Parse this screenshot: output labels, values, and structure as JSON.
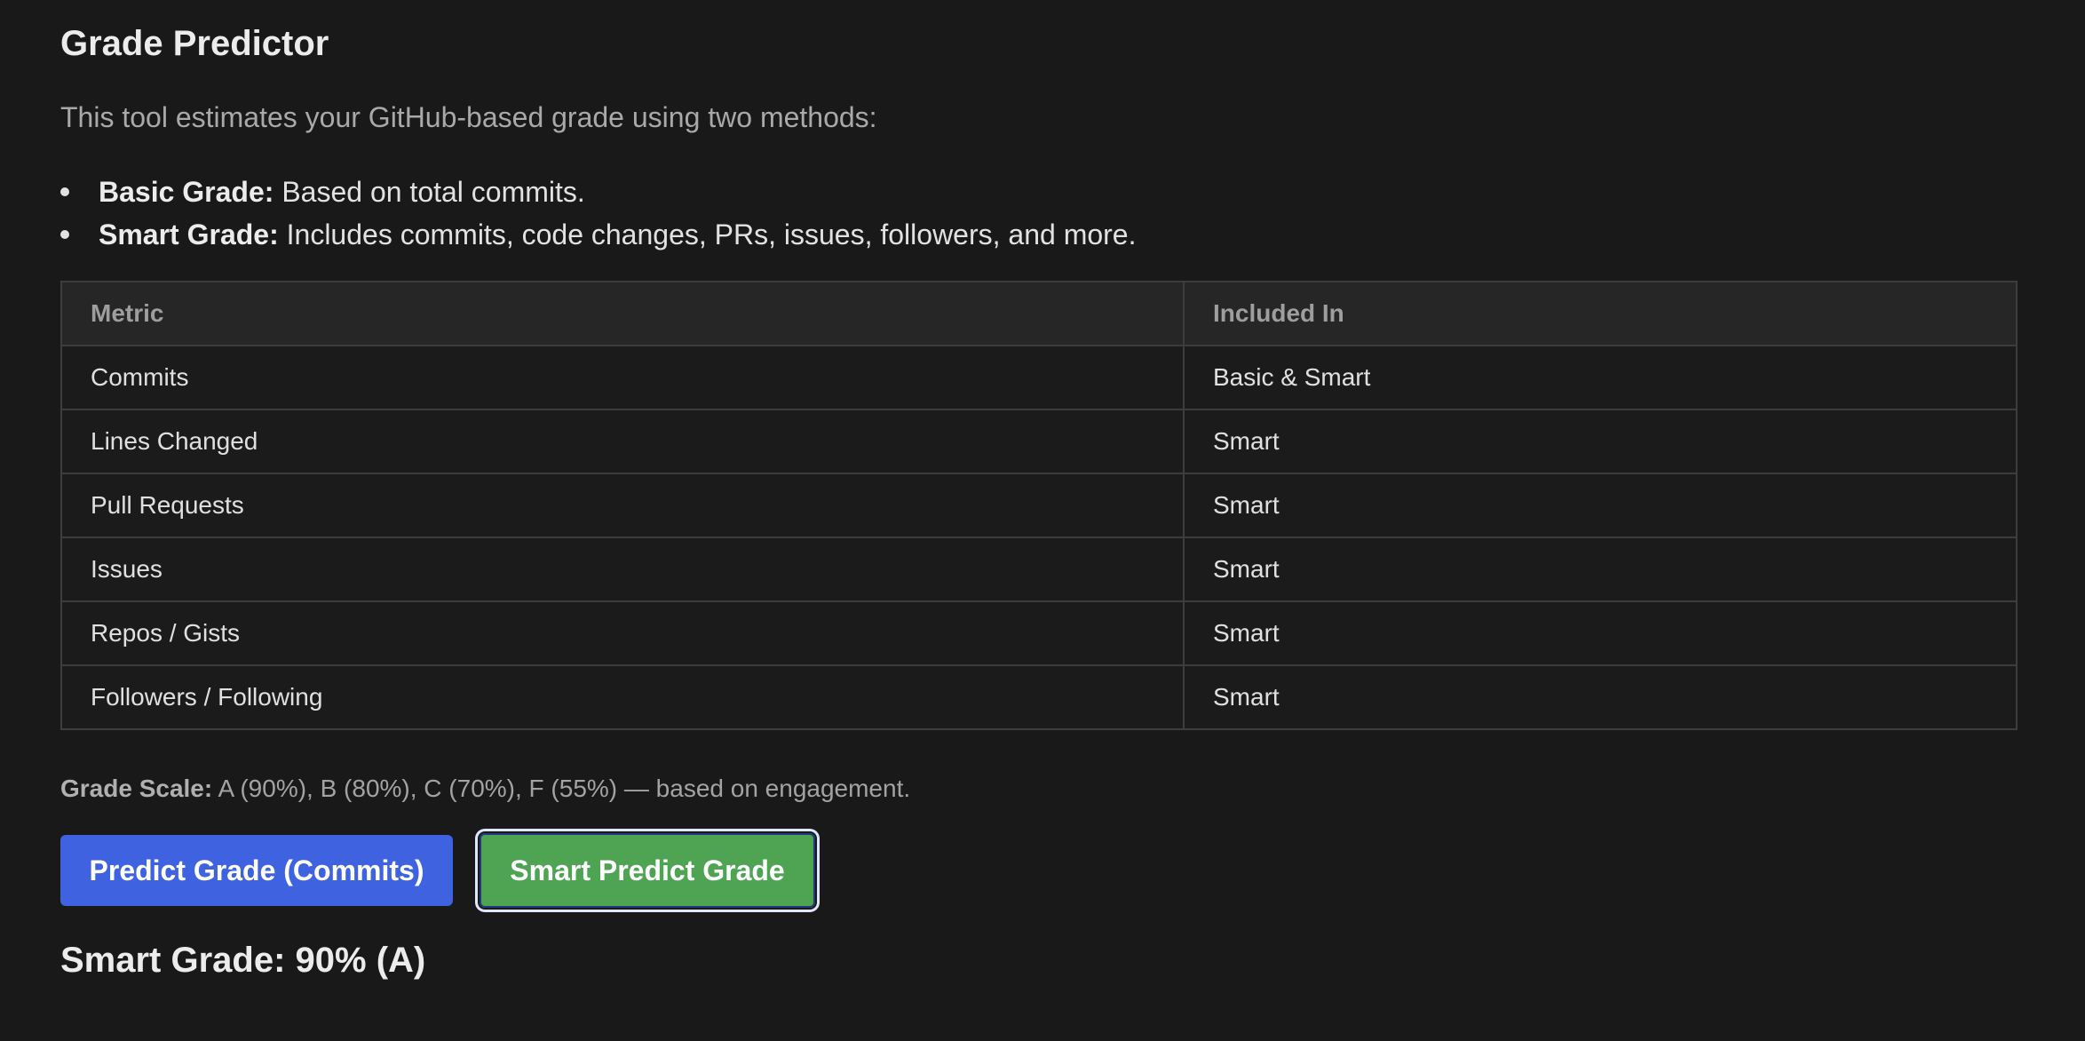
{
  "page": {
    "title": "Grade Predictor",
    "intro": "This tool estimates your GitHub-based grade using two methods:"
  },
  "methods": [
    {
      "label": "Basic Grade:",
      "description": "Based on total commits."
    },
    {
      "label": "Smart Grade:",
      "description": "Includes commits, code changes, PRs, issues, followers, and more."
    }
  ],
  "table": {
    "headers": [
      "Metric",
      "Included In"
    ],
    "rows": [
      [
        "Commits",
        "Basic & Smart"
      ],
      [
        "Lines Changed",
        "Smart"
      ],
      [
        "Pull Requests",
        "Smart"
      ],
      [
        "Issues",
        "Smart"
      ],
      [
        "Repos / Gists",
        "Smart"
      ],
      [
        "Followers / Following",
        "Smart"
      ]
    ]
  },
  "scale": {
    "label": "Grade Scale:",
    "text": "A (90%), B (80%), C (70%), F (55%) — based on engagement."
  },
  "buttons": {
    "basic_label": "Predict Grade (Commits)",
    "smart_label": "Smart Predict Grade"
  },
  "result": {
    "text": "Smart Grade: 90% (A)"
  },
  "colors": {
    "background": "#191919",
    "basic_button": "#3f63e0",
    "smart_button": "#4ea453"
  }
}
